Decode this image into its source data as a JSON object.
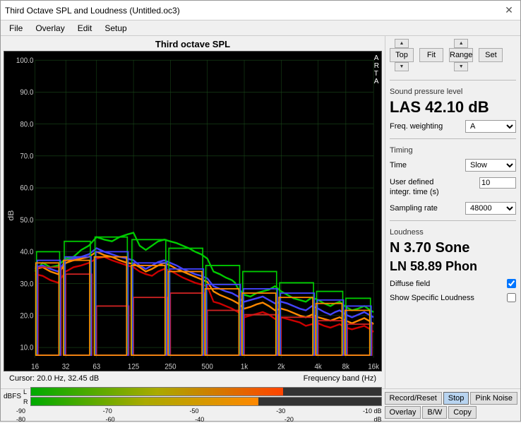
{
  "window": {
    "title": "Third Octave SPL and Loudness (Untitled.oc3)",
    "close_icon": "✕"
  },
  "menu": {
    "items": [
      "File",
      "Overlay",
      "Edit",
      "Setup"
    ]
  },
  "chart": {
    "title": "Third octave SPL",
    "arta_label": "A\nR\nT\nA",
    "y_labels": [
      "100.0",
      "90.0",
      "80.0",
      "70.0",
      "60.0",
      "50.0",
      "40.0",
      "30.0",
      "20.0",
      "10.0"
    ],
    "y_axis_label": "dB",
    "x_labels": [
      "16",
      "32",
      "63",
      "125",
      "250",
      "500",
      "1k",
      "2k",
      "4k",
      "8k",
      "16k"
    ],
    "freq_axis_label": "Frequency band (Hz)",
    "cursor_info": "Cursor:  20.0 Hz, 32.45 dB"
  },
  "nav_controls": {
    "top_label": "Top",
    "fit_label": "Fit",
    "range_label": "Range",
    "set_label": "Set",
    "up_icon": "▲",
    "down_icon": "▼"
  },
  "spl": {
    "section_label": "Sound pressure level",
    "value": "LAS 42.10 dB",
    "freq_weighting_label": "Freq. weighting",
    "freq_weighting_value": "A"
  },
  "timing": {
    "section_label": "Timing",
    "time_label": "Time",
    "time_value": "Slow",
    "user_defined_label": "User defined\nintegr. time (s)",
    "user_defined_value": "10",
    "sampling_rate_label": "Sampling rate",
    "sampling_rate_value": "48000"
  },
  "loudness": {
    "section_label": "Loudness",
    "n_value": "N 3.70 Sone",
    "ln_value": "LN 58.89 Phon",
    "diffuse_field_label": "Diffuse field",
    "show_specific_label": "Show Specific Loudness"
  },
  "bottom": {
    "dbfs_label_l": "L",
    "dbfs_label_r": "R",
    "dbfs_text": "dBFS",
    "ticks_top": [
      "-90",
      "-70",
      "-50",
      "-30",
      "-10 dB"
    ],
    "ticks_bottom": [
      "-80",
      "-60",
      "-40",
      "-20",
      "dB"
    ],
    "buttons": [
      "Record/Reset",
      "Stop",
      "Pink Noise",
      "Overlay",
      "B/W",
      "Copy"
    ]
  }
}
